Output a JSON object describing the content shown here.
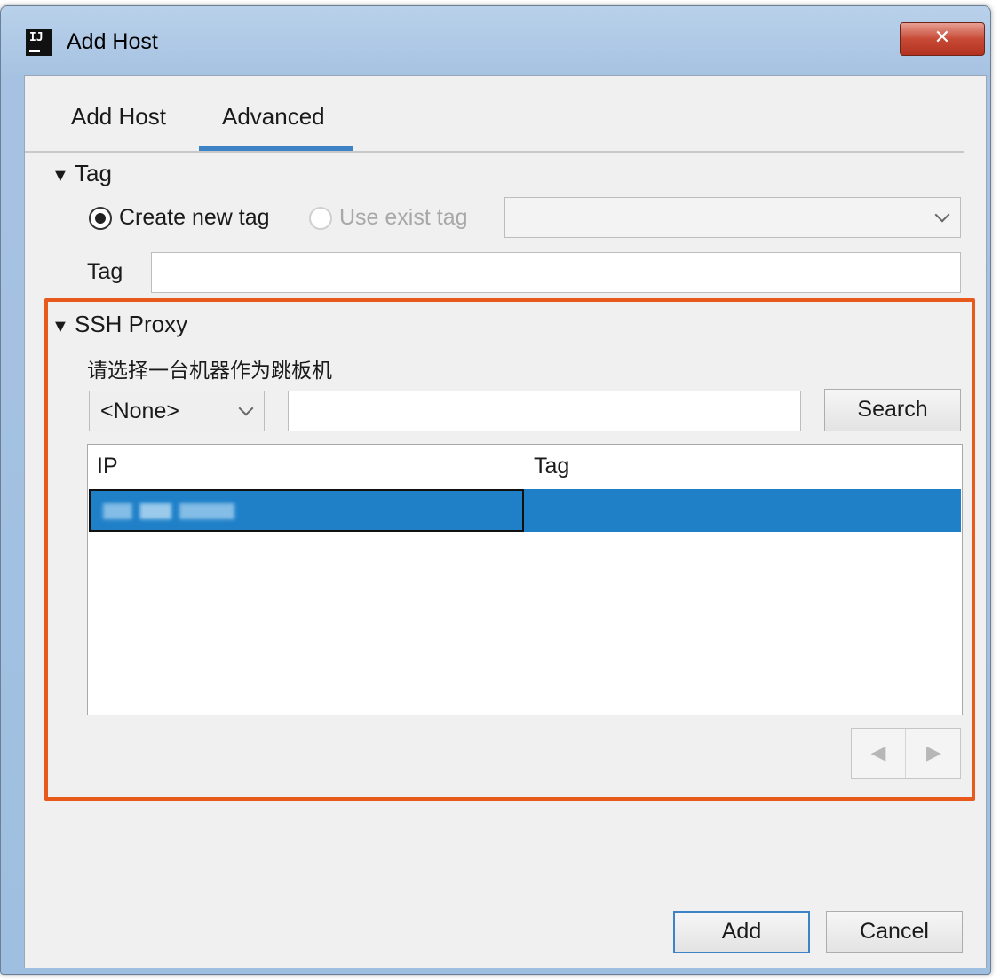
{
  "window": {
    "title": "Add Host",
    "app_icon_text": "IJ",
    "close_glyph": "✕"
  },
  "tabs": [
    {
      "label": "Add Host"
    },
    {
      "label": "Advanced"
    }
  ],
  "tag_section": {
    "header": "Tag",
    "radio_create": "Create new tag",
    "radio_exist": "Use exist tag",
    "tag_label": "Tag",
    "tag_value": ""
  },
  "ssh_section": {
    "header": "SSH Proxy",
    "instruction": "请选择一台机器作为跳板机",
    "select_value": "<None>",
    "search_value": "",
    "search_button": "Search",
    "columns": [
      "IP",
      "Tag"
    ],
    "rows": [
      {
        "ip": "",
        "tag": ""
      }
    ]
  },
  "footer": {
    "add_button": "Add",
    "cancel_button": "Cancel"
  },
  "colors": {
    "accent": "#3d83c6",
    "highlight_border": "#e85a1c",
    "selection": "#1f80c8"
  },
  "icons": {
    "collapse": "triangle-down-icon",
    "dropdown": "chevron-down-icon",
    "prev": "arrow-left-icon",
    "next": "arrow-right-icon",
    "close": "close-icon"
  }
}
